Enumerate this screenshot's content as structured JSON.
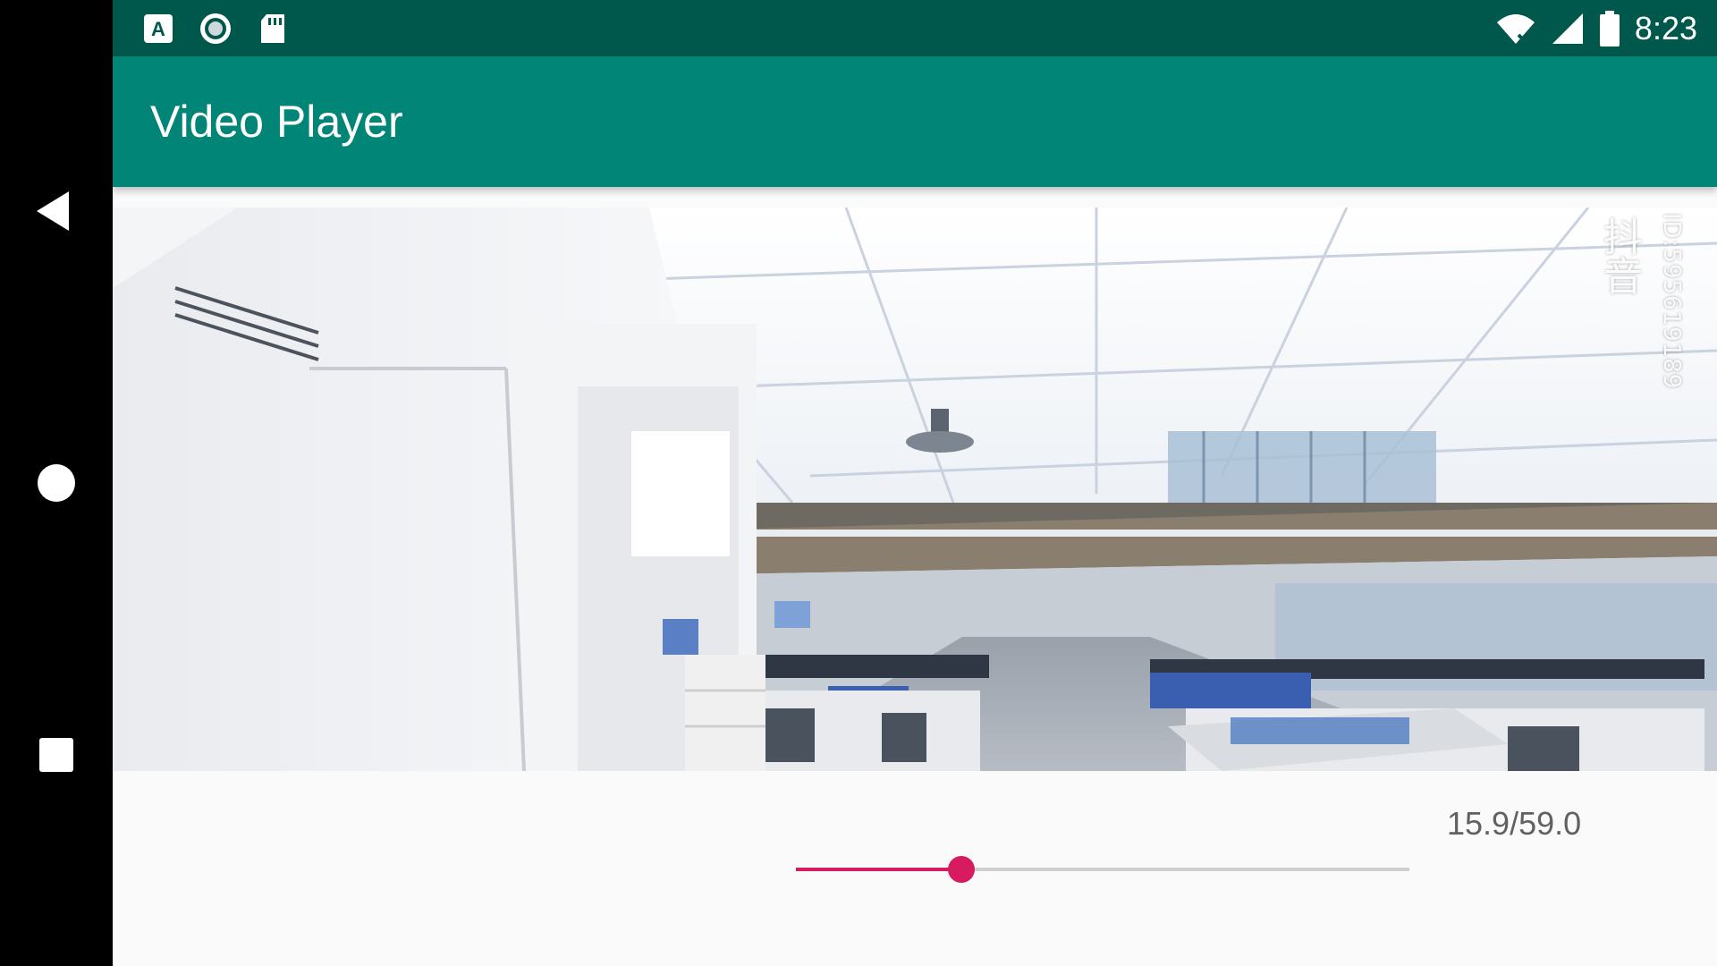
{
  "status_bar": {
    "time": "8:23",
    "left_icons": [
      "a-notification-icon",
      "record-circle-icon",
      "sd-card-icon"
    ],
    "right_icons": [
      "wifi-no-internet-icon",
      "cellular-signal-icon",
      "battery-icon"
    ]
  },
  "navigation": {
    "buttons": [
      "back-icon",
      "home-icon",
      "recents-icon"
    ]
  },
  "toolbar": {
    "title": "Video Player"
  },
  "video": {
    "watermark_logo": "抖音",
    "watermark_id": "ID:595619189"
  },
  "playback": {
    "time_readout": "15.9/59.0",
    "current_seconds": 15.9,
    "duration_seconds": 59.0
  },
  "colors": {
    "status_bar": "#00574b",
    "toolbar": "#008577",
    "accent": "#d81b60",
    "nav_bar": "#000000"
  }
}
